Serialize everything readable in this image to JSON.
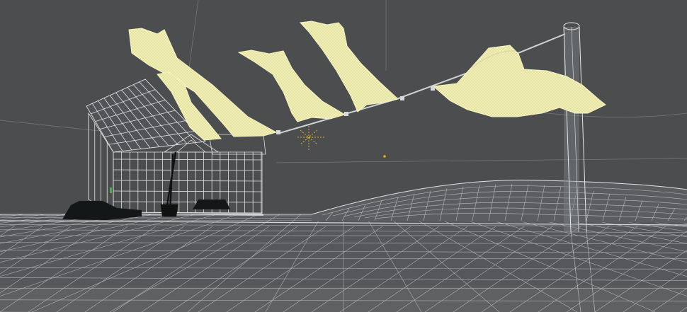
{
  "viewport": {
    "view": "3d-wireframe-perspective",
    "background_color": "#4b4d4f",
    "wire_color": "#d9dcdc",
    "cloth_color": "#f4f2b8",
    "cloth_wire_color": "#c9c68a",
    "ground_color": "#5a5c5e",
    "dark_object_color": "#151818",
    "pivot_color": "#e0b020",
    "axis_y_color": "#30c040"
  },
  "scene": {
    "objects": [
      "house-wireframe",
      "ground-terrain-wireframe",
      "hill-wireframe",
      "clothesline-pole",
      "clothesline-rope",
      "cloth-sheet-1",
      "cloth-sheet-2",
      "cloth-sheet-3",
      "cloth-sheet-4",
      "cloth-sheet-5",
      "cloth-sheet-large",
      "dark-rock-left",
      "dark-rock-center",
      "rake-tool"
    ],
    "pivot_icon": "crosshair-pivot-icon"
  }
}
